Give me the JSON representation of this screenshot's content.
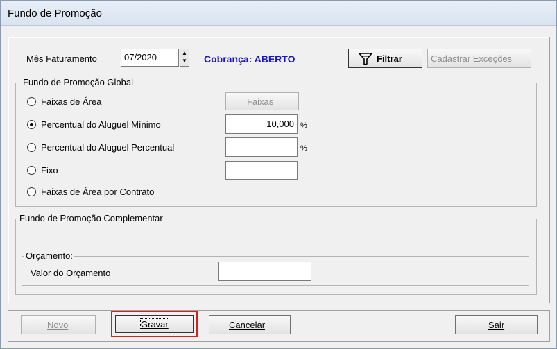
{
  "window": {
    "title": "Fundo de Promoção"
  },
  "header": {
    "mes_label": "Mês Faturamento",
    "mes_value": "07/2020",
    "status_text": "Cobrança: ABERTO",
    "status_color": "#1a14c8",
    "filtrar_label": "Filtrar",
    "cadastrar_label": "Cadastrar Exceções"
  },
  "global": {
    "title": "Fundo de Promoção Global",
    "options": [
      {
        "label": "Faixas de Área",
        "selected": false
      },
      {
        "label": "Percentual do Aluguel Mínimo",
        "selected": true
      },
      {
        "label": "Percentual do Aluguel Percentual",
        "selected": false
      },
      {
        "label": "Fixo",
        "selected": false
      },
      {
        "label": "Faixas de Área por Contrato",
        "selected": false
      }
    ],
    "faixas_button": "Faixas",
    "percentual_minimo_value": "10,000",
    "percent_symbol": "%",
    "percentual_percentual_value": "",
    "fixo_value": ""
  },
  "complementar": {
    "title": "Fundo de Promoção Complementar",
    "orcamento_title": "Orçamento:",
    "valor_label": "Valor do Orçamento",
    "valor_value": ""
  },
  "footer": {
    "novo": "Novo",
    "gravar": "Gravar",
    "cancelar": "Cancelar",
    "sair": "Sair"
  },
  "highlight_color": "#d42020"
}
